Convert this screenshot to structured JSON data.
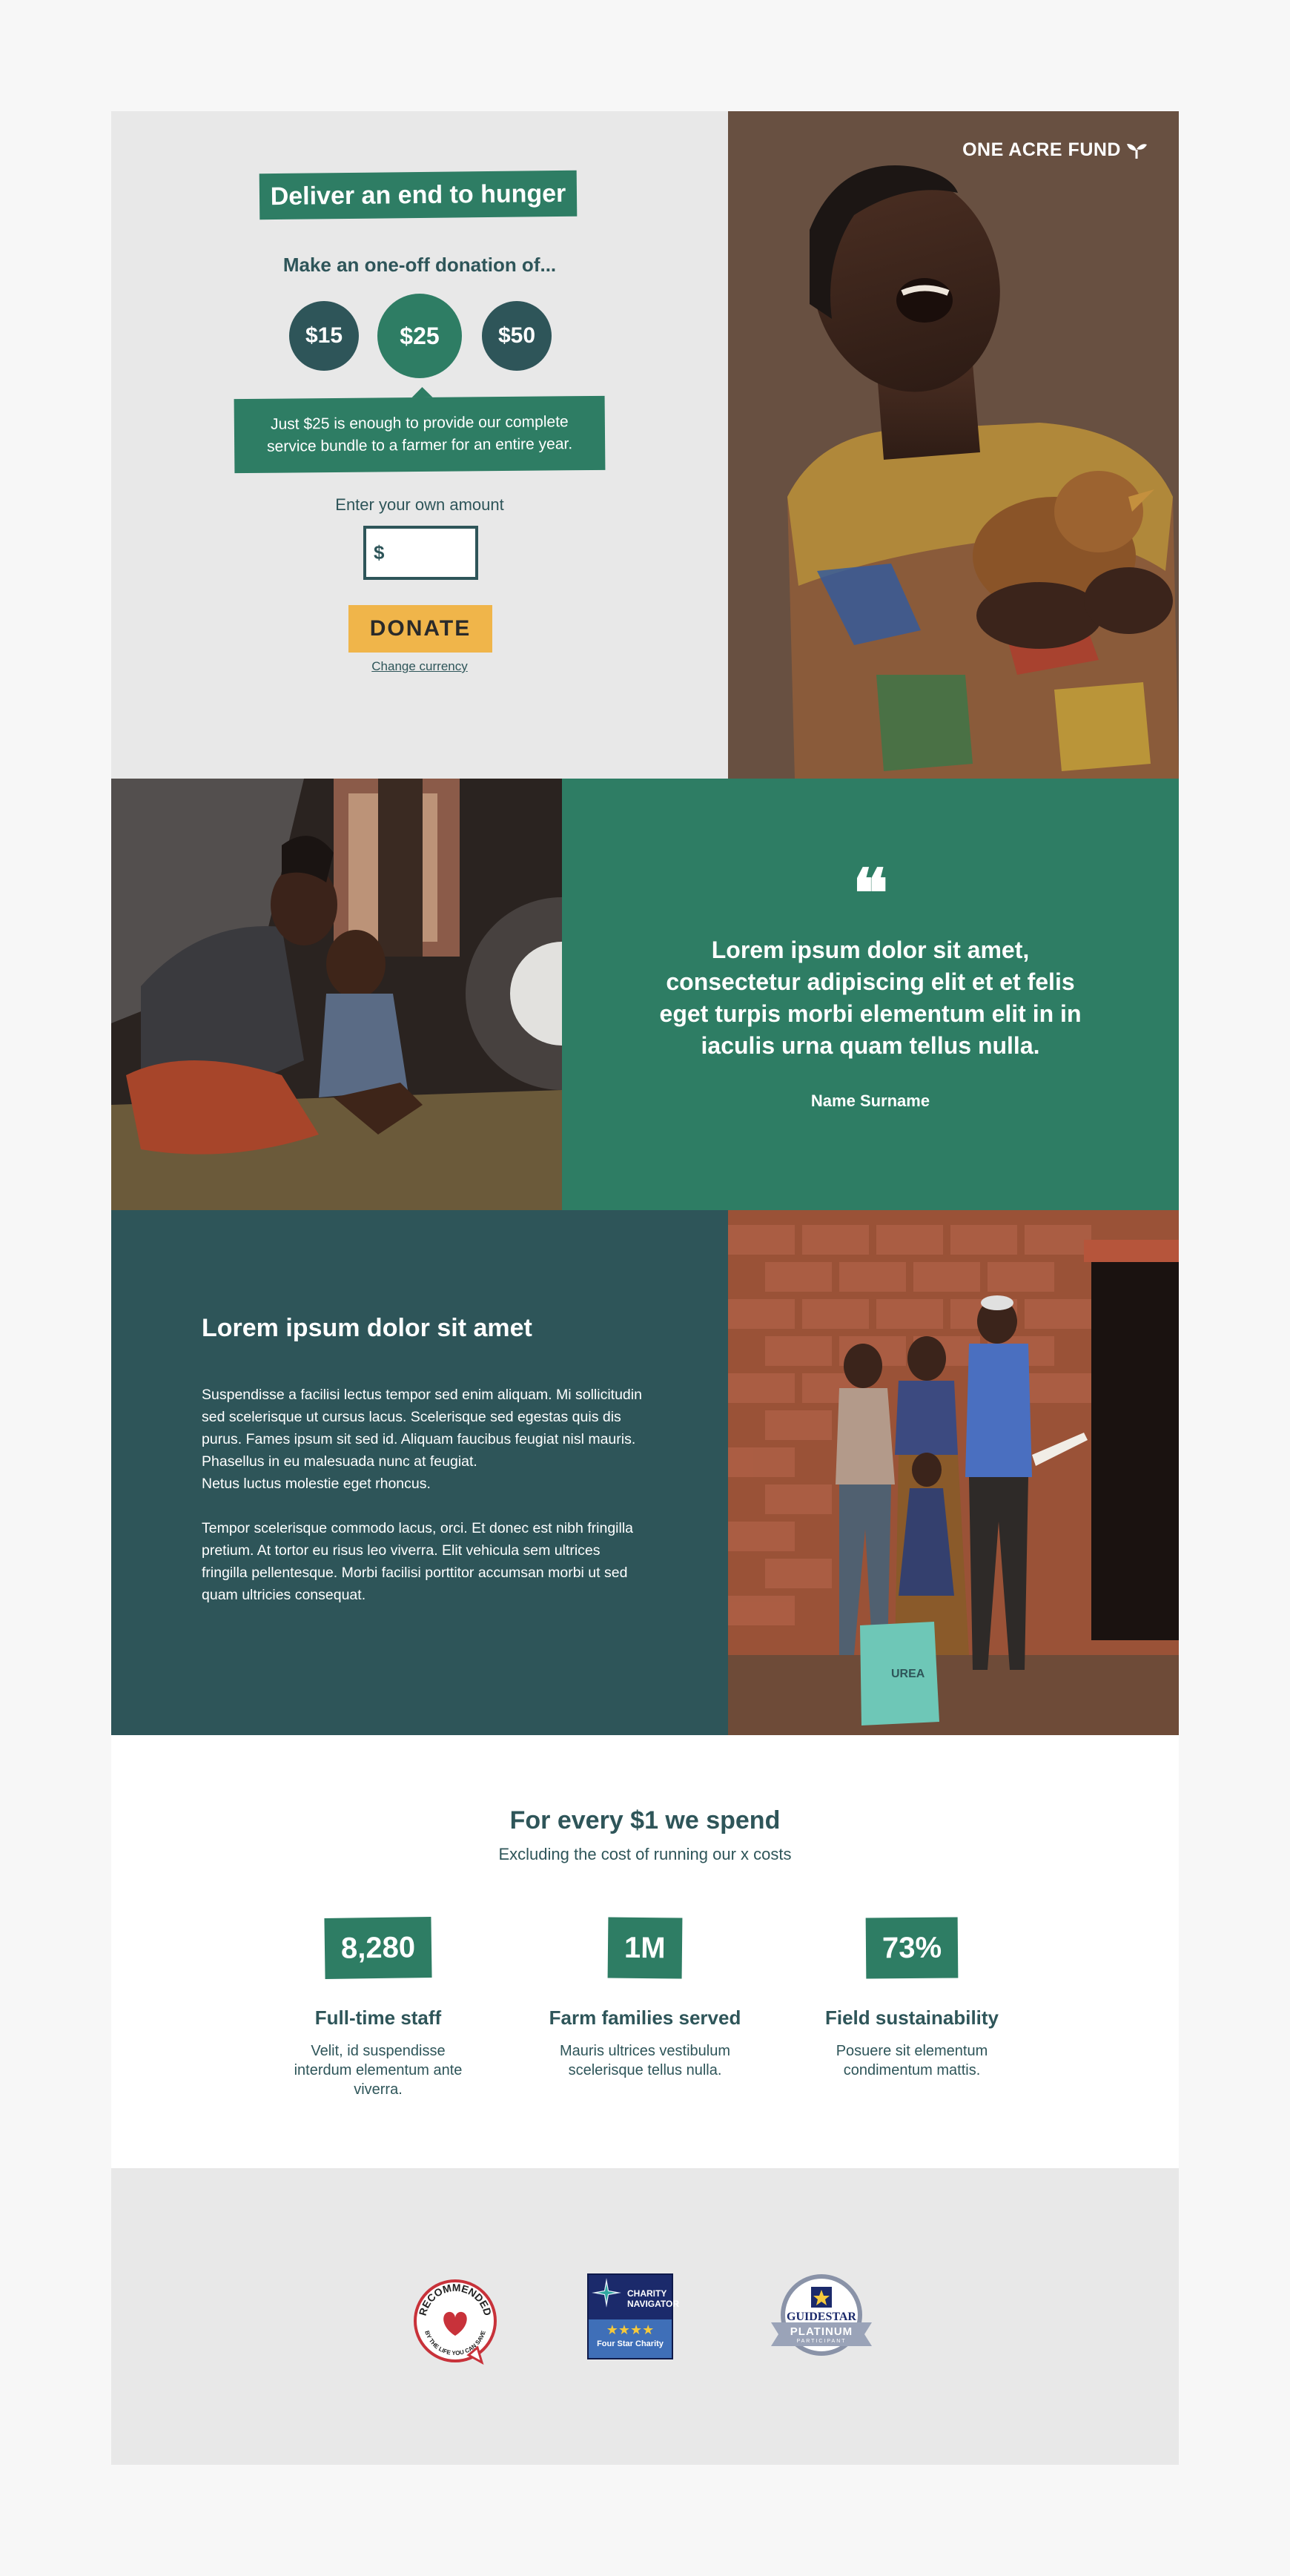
{
  "brand": {
    "logo_text": "ONE ACRE FUND"
  },
  "hero": {
    "headline": "Deliver an end to hunger",
    "subhead": "Make an one-off donation of...",
    "amounts": [
      "$15",
      "$25",
      "$50"
    ],
    "selected_amount": "$25",
    "tooltip": "Just $25 is enough to provide our complete service bundle to a farmer for an entire year.",
    "own_amount_label": "Enter your own amount",
    "currency_symbol": "$",
    "own_amount_value": "",
    "donate_label": "DONATE",
    "change_currency": "Change currency"
  },
  "quote": {
    "text": "Lorem ipsum dolor sit amet, consectetur adipiscing elit et et felis eget turpis morbi elementum elit in in iaculis urna quam tellus nulla.",
    "name": "Name Surname"
  },
  "story": {
    "title": "Lorem ipsum dolor sit amet",
    "paragraph1": "Suspendisse a facilisi lectus tempor sed enim aliquam. Mi sollicitudin sed scelerisque ut cursus lacus. Scelerisque sed egestas quis dis purus. Fames ipsum sit sed id. Aliquam faucibus feugiat nisl mauris. Phasellus in eu malesuada nunc at feugiat.",
    "paragraph1b": "Netus luctus molestie eget rhoncus.",
    "paragraph2": "Tempor scelerisque commodo lacus, orci. Et donec est nibh fringilla pretium. At tortor eu risus leo viverra. Elit vehicula sem ultrices fringilla pellentesque. Morbi facilisi porttitor accumsan morbi ut sed quam ultricies consequat."
  },
  "stats": {
    "title": "For every $1 we spend",
    "subtitle": "Excluding the cost of  running our x costs",
    "items": [
      {
        "value": "8,280",
        "label": "Full-time staff",
        "desc": "Velit, id suspendisse interdum elementum ante viverra."
      },
      {
        "value": "1M",
        "label": "Farm families served",
        "desc": "Mauris ultrices vestibulum scelerisque tellus nulla."
      },
      {
        "value": "73%",
        "label": "Field sustainability",
        "desc": "Posuere sit elementum condimentum mattis."
      }
    ]
  },
  "badges": {
    "recommended_top": "RECOMMENDED",
    "recommended_bottom": "BY THE LIFE YOU CAN SAVE",
    "charity_navigator_1": "CHARITY",
    "charity_navigator_2": "NAVIGATOR",
    "charity_navigator_stars": "★★★★",
    "charity_navigator_label": "Four Star Charity",
    "guidestar_name": "GUIDESTAR",
    "guidestar_level": "PLATINUM",
    "guidestar_sub": "PARTICIPANT"
  },
  "colors": {
    "green": "#2e7d64",
    "teal_dark": "#2e5559",
    "gold": "#f0b54a",
    "light_gray": "#e8e8e8"
  }
}
